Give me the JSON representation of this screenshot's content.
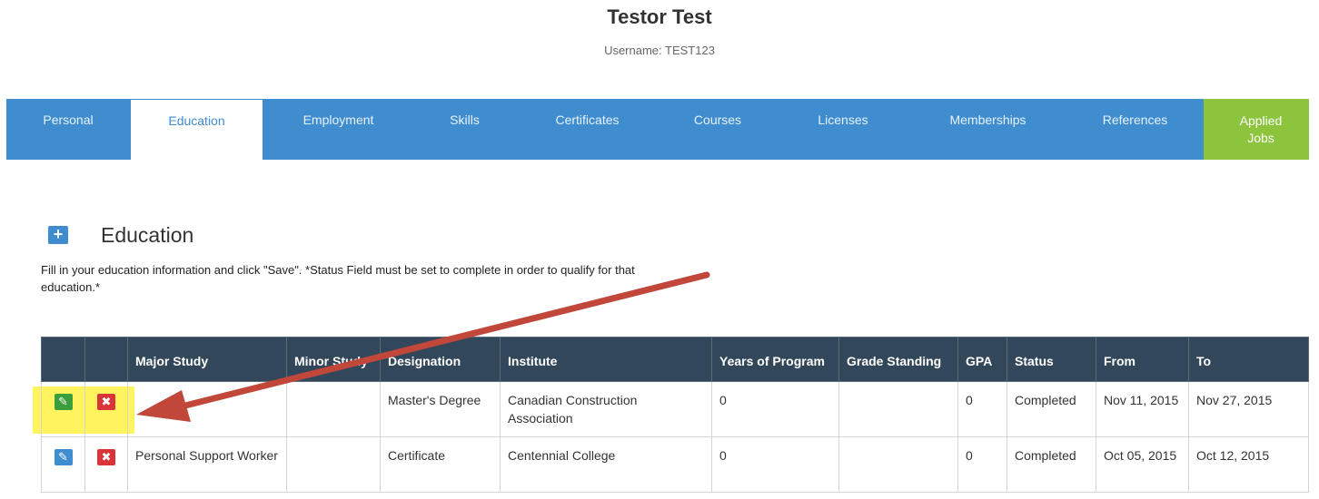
{
  "header": {
    "name": "Testor Test",
    "username": "Username: TEST123"
  },
  "nav": {
    "items": [
      {
        "label": "Personal"
      },
      {
        "label": "Education"
      },
      {
        "label": "Employment"
      },
      {
        "label": "Skills"
      },
      {
        "label": "Certificates"
      },
      {
        "label": "Courses"
      },
      {
        "label": "Licenses"
      },
      {
        "label": "Memberships"
      },
      {
        "label": "References"
      },
      {
        "label": "Applied Jobs"
      }
    ],
    "active": "Education",
    "colors": {
      "bar": "#3f8ccf",
      "applied": "#8cc43d"
    }
  },
  "section": {
    "add_icon": "plus-icon",
    "title": "Education",
    "instructions": "Fill in your education information and click \"Save\". *Status Field must be set to complete in order to qualify for that education.*"
  },
  "table": {
    "headers": [
      "",
      "",
      "Major Study",
      "Minor Study",
      "Designation",
      "Institute",
      "Years of Program",
      "Grade Standing",
      "GPA",
      "Status",
      "From",
      "To"
    ],
    "rows": [
      {
        "major": "",
        "minor": "",
        "designation": "Master's Degree",
        "institute": "Canadian Construction Association",
        "years": "0",
        "grade": "",
        "gpa": "0",
        "status": "Completed",
        "from": "Nov 11, 2015",
        "to": "Nov 27, 2015"
      },
      {
        "major": "Personal Support Worker",
        "minor": "",
        "designation": "Certificate",
        "institute": "Centennial College",
        "years": "0",
        "grade": "",
        "gpa": "0",
        "status": "Completed",
        "from": "Oct 05, 2015",
        "to": "Oct 12, 2015"
      }
    ],
    "edit_icon": "pencil-icon",
    "delete_icon": "close-icon"
  },
  "annotation": {
    "highlight_color": "#fff23a",
    "arrow_color": "#c0473a"
  }
}
